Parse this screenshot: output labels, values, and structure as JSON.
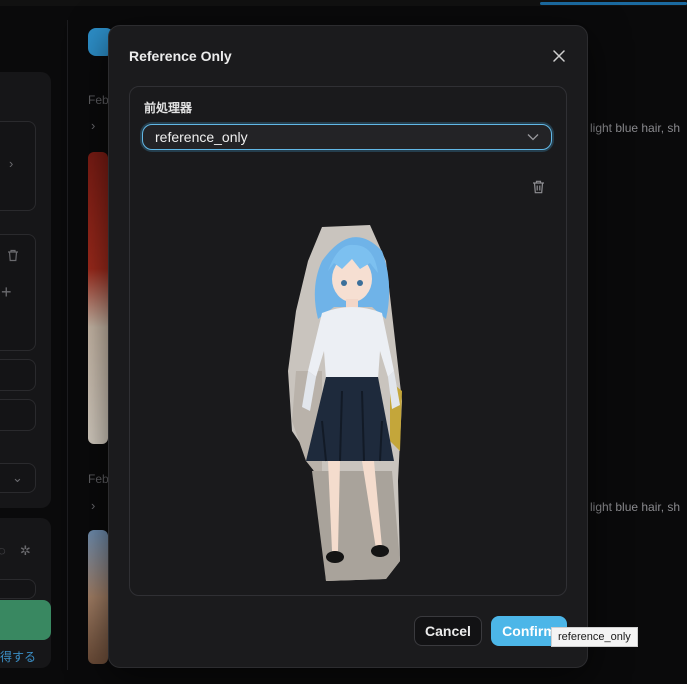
{
  "background": {
    "date_label": "Feb",
    "prompt_snippet": "light blue hair, sh",
    "link_text": "得する"
  },
  "modal": {
    "title": "Reference Only",
    "preprocessor_label": "前処理器",
    "preprocessor_value": "reference_only",
    "cancel_label": "Cancel",
    "confirm_label": "Confirm",
    "tooltip_text": "reference_only"
  },
  "colors": {
    "accent": "#4cb6e8",
    "modal_bg": "#1b1b1d",
    "page_bg": "#0a0a0b"
  },
  "icons": {
    "close": "close-icon",
    "chevron": "chevron-down-icon",
    "trash": "trash-icon"
  }
}
